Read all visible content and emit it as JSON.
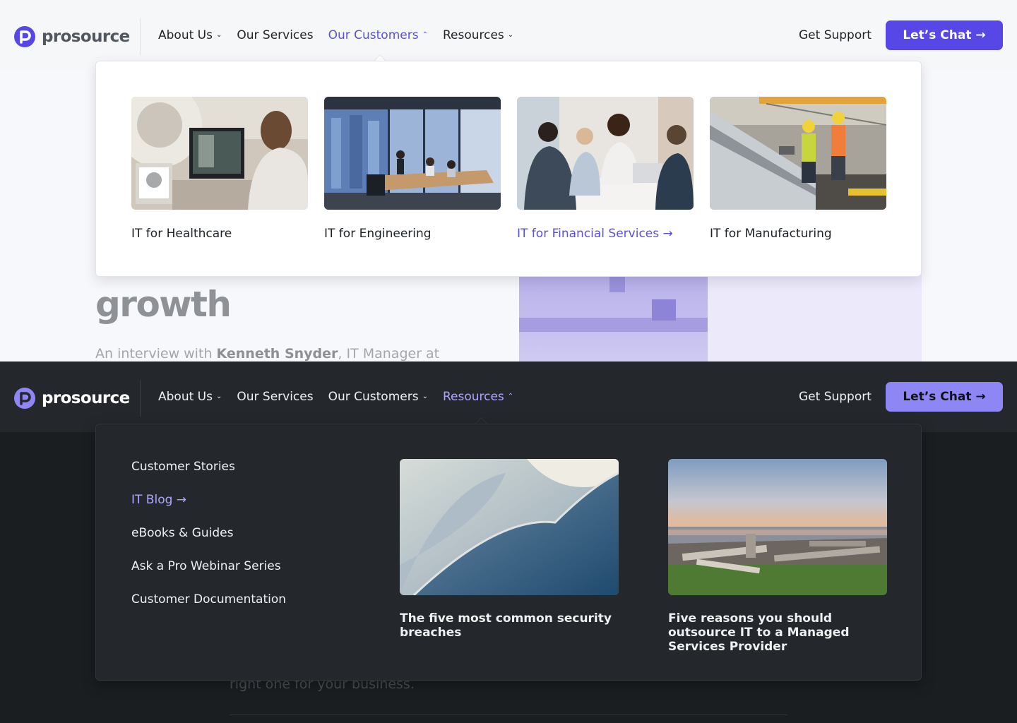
{
  "brand": {
    "name": "prosource",
    "accent_light": "#5647e6",
    "accent_dark": "#8f86f5"
  },
  "nav": {
    "items": [
      {
        "label": "About Us",
        "has_dropdown": true
      },
      {
        "label": "Our Services",
        "has_dropdown": false
      },
      {
        "label": "Our Customers",
        "has_dropdown": true
      },
      {
        "label": "Resources",
        "has_dropdown": true
      }
    ],
    "support_label": "Get Support",
    "cta_label": "Let’s Chat →"
  },
  "light_state": {
    "open_menu": "Our Customers",
    "background": {
      "heading": "growth",
      "subtitle_prefix": "An interview with ",
      "subtitle_name": "Kenneth Snyder",
      "subtitle_suffix": ", IT Manager at"
    },
    "industries": [
      {
        "label": "IT for Healthcare",
        "icon": "healthcare-photo",
        "active": false
      },
      {
        "label": "IT for Engineering",
        "icon": "engineering-photo",
        "active": false
      },
      {
        "label": "IT for Financial Services →",
        "icon": "financial-photo",
        "active": true
      },
      {
        "label": "IT for Manufacturing",
        "icon": "manufacturing-photo",
        "active": false
      }
    ]
  },
  "dark_state": {
    "open_menu": "Resources",
    "background": {
      "text": "right one for your business."
    },
    "resources": [
      {
        "label": "Customer Stories",
        "active": false
      },
      {
        "label": "IT Blog →",
        "active": true
      },
      {
        "label": "eBooks & Guides",
        "active": false
      },
      {
        "label": "Ask a Pro Webinar Series",
        "active": false
      },
      {
        "label": "Customer Documentation",
        "active": false
      }
    ],
    "articles": [
      {
        "title": "The five most common security breaches",
        "icon": "abstract-wave-photo"
      },
      {
        "title": "Five reasons you should outsource IT to a Managed Services Provider",
        "icon": "driftwood-beach-photo"
      }
    ]
  }
}
